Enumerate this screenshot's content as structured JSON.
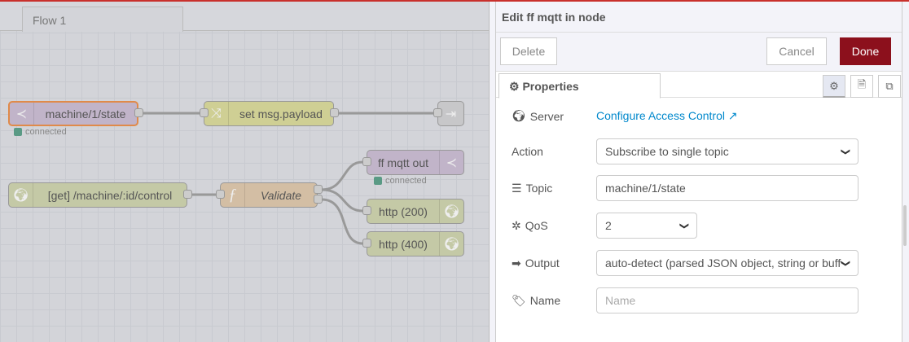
{
  "workspace": {
    "tab": "Flow 1"
  },
  "nodes": {
    "mqtt_in": {
      "label": "machine/1/state",
      "status": "connected",
      "icon": "bridge-icon"
    },
    "change": {
      "label": "set msg.payload",
      "icon": "shuffle-icon"
    },
    "link_out": {
      "icon": "link-out-icon"
    },
    "mqtt_out": {
      "label": "ff mqtt out",
      "status": "connected",
      "icon": "bridge-icon"
    },
    "http_in": {
      "label": "[get] /machine/:id/control",
      "icon": "globe-icon"
    },
    "function": {
      "label": "Validate",
      "icon": "function-icon"
    },
    "http_200": {
      "label": "http (200)",
      "icon": "globe-icon"
    },
    "http_400": {
      "label": "http (400)",
      "icon": "globe-icon"
    }
  },
  "panel": {
    "title": "Edit ff mqtt in node",
    "delete": "Delete",
    "cancel": "Cancel",
    "done": "Done",
    "tab": "Properties",
    "form": {
      "server_label": "Server",
      "server_link": "Configure Access Control",
      "action_label": "Action",
      "action_value": "Subscribe to single topic",
      "topic_label": "Topic",
      "topic_value": "machine/1/state",
      "qos_label": "QoS",
      "qos_value": "2",
      "output_label": "Output",
      "output_value": "auto-detect (parsed JSON object, string or buffer)",
      "name_label": "Name",
      "name_placeholder": "Name"
    }
  },
  "colors": {
    "accent": "#8c101c",
    "link": "#0088cc",
    "top_bar": "#c9302c",
    "status": "#5a9a85"
  }
}
